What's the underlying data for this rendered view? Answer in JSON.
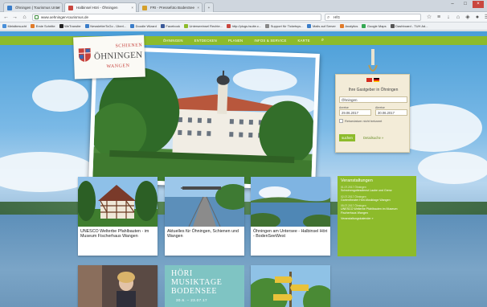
{
  "browser": {
    "tabs": [
      {
        "title": "Öhningen | Tourismus Unter",
        "color": "#3a7dc9",
        "active": false
      },
      {
        "title": "Halbinsel Höri - Öhningen",
        "color": "#c9473f",
        "active": true
      },
      {
        "title": "FRI - Pressefoto BodenSee",
        "color": "#d5a02a",
        "active": false
      }
    ],
    "url": "www.oehningen-tourismus.de",
    "search_value": "HfG",
    "bookmarks": [
      {
        "label": "Meistbesucht",
        "color": "#4a90d9"
      },
      {
        "label": "Erste Schritte",
        "color": "#e07b2a"
      },
      {
        "label": "WeTransfer",
        "color": "#222222"
      },
      {
        "label": "NewsletterToGo - Überl...",
        "color": "#3a7dc9"
      },
      {
        "label": "Doodle Wizard",
        "color": "#3a7dc9"
      },
      {
        "label": "Facebook",
        "color": "#3b5998"
      },
      {
        "label": "Unterseeinsel Rechte...",
        "color": "#8dbb2b"
      },
      {
        "label": "http://plugs.tsuite.c...",
        "color": "#c9473f"
      },
      {
        "label": "Support für Ticketsys...",
        "color": "#888888"
      },
      {
        "label": "Mails auf Server",
        "color": "#3a7dc9"
      },
      {
        "label": "Analytics",
        "color": "#e07b2a"
      },
      {
        "label": "Google Maps",
        "color": "#34a853"
      },
      {
        "label": "Dashboard - TUH Ad...",
        "color": "#555555"
      }
    ]
  },
  "site": {
    "nav": [
      "ÖHNINGEN",
      "ENTDECKEN",
      "PLANEN",
      "INFOS & SERVICE",
      "KARTE"
    ],
    "logo": {
      "top": "SCHIENEN",
      "middle": "ÖHNINGEN",
      "bottom": "WANGEN"
    },
    "host": {
      "title": "Ihre Gastgeber in Öhningen",
      "place": "Öhningen",
      "arrival_label": "Anreise",
      "arrival": "29.06.2017",
      "departure_label": "Abreise",
      "departure": "30.06.2017",
      "checkbox_label": "Reisedatum nicht bekannt",
      "search_button": "suchen",
      "detail_link": "Detailsuche »"
    },
    "cards": [
      {
        "caption": "UNESCO Welterbe Pfahlbauten - im Museum Fischerhaus Wangen"
      },
      {
        "caption": "Aktuelles für Öhningen, Schienen und Wangen"
      },
      {
        "caption": "Öhningen am Untersee - Halbinsel Höri - BodenSeeWest"
      }
    ],
    "musiktage": {
      "title": "HÖRI MUSIKTAGE BODENSEE",
      "dates": "30.6. – 23.07.17"
    },
    "events": {
      "title": "Veranstaltungen",
      "items": [
        {
          "date": "01.07.2017 Öhningen",
          "text": "Schwimmgottesdienst Laube und Grenz"
        },
        {
          "date": "02.07.2017 Öhningen",
          "text": "Gartentheater Höri-Musiktage Wangen"
        },
        {
          "date": "05.07.2017 Öhningen",
          "text": "UNESCO Welterbe Pfahlbauten im Museum Fischerhaus Wangen"
        }
      ],
      "more": "Veranstaltungskalender »"
    }
  }
}
